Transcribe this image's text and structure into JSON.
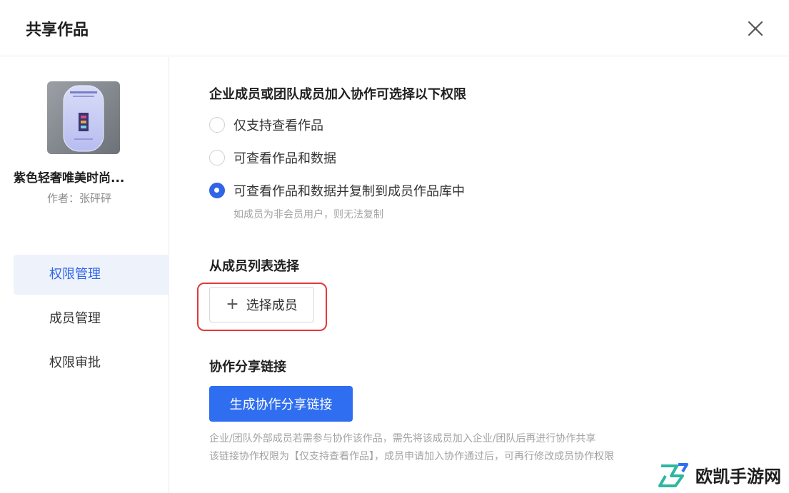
{
  "dialog": {
    "title": "共享作品",
    "close_icon": "close-icon"
  },
  "work": {
    "title": "紫色轻奢唯美时尚...",
    "author": "作者：张砰砰"
  },
  "sidebar": {
    "items": [
      {
        "label": "权限管理",
        "active": true
      },
      {
        "label": "成员管理",
        "active": false
      },
      {
        "label": "权限审批",
        "active": false
      }
    ]
  },
  "permissions": {
    "title": "企业成员或团队成员加入协作可选择以下权限",
    "options": [
      {
        "label": "仅支持查看作品",
        "checked": false
      },
      {
        "label": "可查看作品和数据",
        "checked": false
      },
      {
        "label": "可查看作品和数据并复制到成员作品库中",
        "checked": true
      }
    ],
    "hint": "如成员为非会员用户，则无法复制"
  },
  "member_select": {
    "title": "从成员列表选择",
    "button_label": "选择成员"
  },
  "share_link": {
    "title": "协作分享链接",
    "button_label": "生成协作分享链接",
    "note_1": "企业/团队外部成员若需参与协作该作品，需先将该成员加入企业/团队后再进行协作共享",
    "note_2": "该链接协作权限为【仅支持查看作品】，成员申请加入协作通过后，可再行修改成员协作权限"
  },
  "watermark": {
    "text": "欧凯手游网"
  },
  "colors": {
    "accent": "#2f6ef0",
    "highlight": "#e0393a"
  }
}
